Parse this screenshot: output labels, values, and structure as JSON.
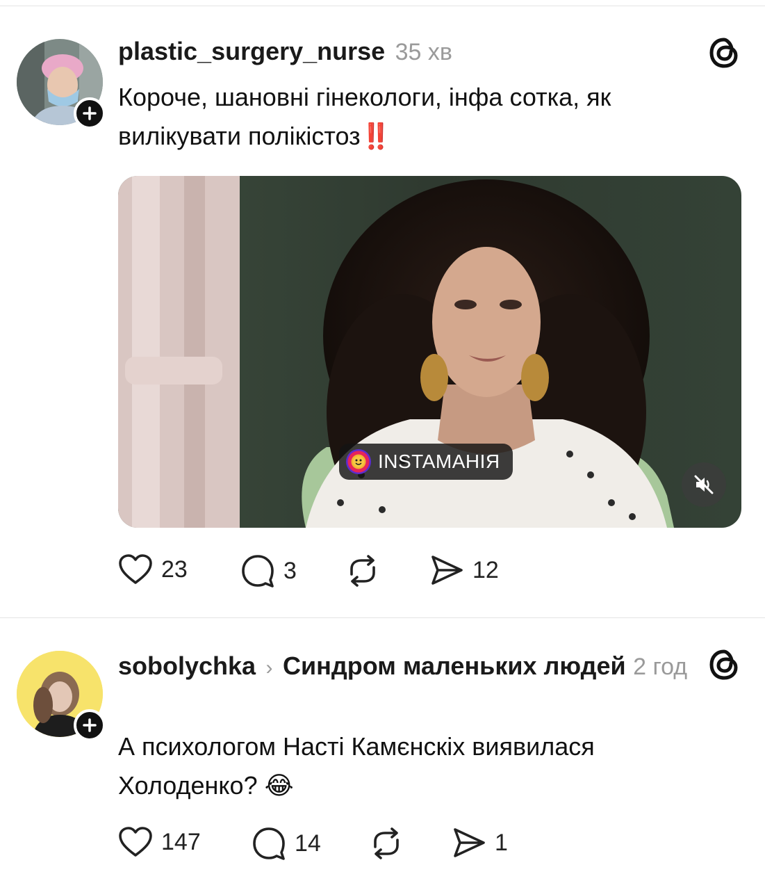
{
  "posts": [
    {
      "username": "plastic_surgery_nurse",
      "time": "35 хв",
      "text": "Короче, шановні гінекологи, інфа сотка, як вилікувати полікістоз",
      "text_emoji": "‼️",
      "media": {
        "watermark": "INSTAMAHIЯ",
        "mute_icon": "speaker-muted-icon"
      },
      "stats": {
        "likes": "23",
        "replies": "3",
        "shares": "12"
      }
    },
    {
      "username": "sobolychka",
      "topic": "Синдром маленьких людей",
      "time": "2 год",
      "text": "А психологом Насті Камєнскіх виявилася Холоденко?",
      "text_emoji": "😂",
      "stats": {
        "likes": "147",
        "replies": "14",
        "shares": "1"
      }
    }
  ],
  "icons": {
    "avatar_badge": "plus-icon",
    "app": "threads-logo-icon",
    "like": "heart-icon",
    "reply": "comment-icon",
    "repost": "repost-icon",
    "share": "send-icon"
  },
  "colors": {
    "text": "#101010",
    "muted": "#9a9a9a",
    "badge": "#111111",
    "avatar2_bg": "#f7e36b"
  }
}
